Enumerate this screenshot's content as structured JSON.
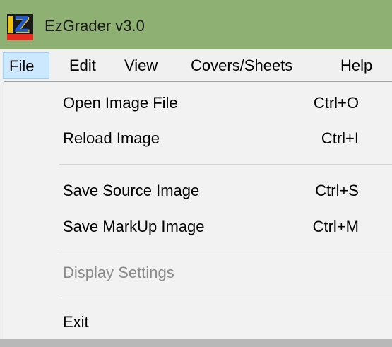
{
  "window": {
    "title": "EzGrader v3.0",
    "icon_name": "ezgrader-app-icon",
    "icon_letter": "Z",
    "titlebar_color": "#8eb173"
  },
  "menubar": {
    "items": [
      {
        "label": "File",
        "active": true
      },
      {
        "label": "Edit"
      },
      {
        "label": "View"
      },
      {
        "label": "Covers/Sheets"
      },
      {
        "label": "Help"
      }
    ],
    "active_highlight": "#cce8ff"
  },
  "file_menu": {
    "items": [
      {
        "label": "Open Image File",
        "shortcut": "Ctrl+O"
      },
      {
        "label": "Reload Image",
        "shortcut": "Ctrl+I"
      },
      {
        "label": "Save Source Image",
        "shortcut": "Ctrl+S"
      },
      {
        "label": "Save MarkUp Image",
        "shortcut": "Ctrl+M"
      },
      {
        "label": "Display Settings",
        "disabled": true
      },
      {
        "label": "Exit"
      }
    ]
  }
}
